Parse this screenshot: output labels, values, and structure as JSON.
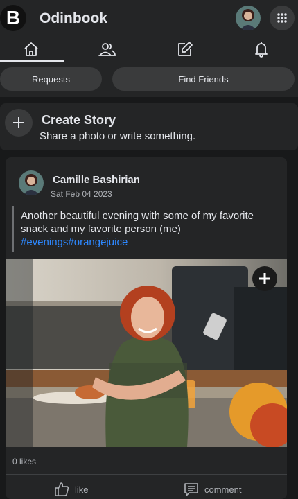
{
  "app": {
    "logo_letter": "B",
    "name": "Odinbook"
  },
  "nav": {
    "tabs": [
      {
        "name": "home",
        "active": true
      },
      {
        "name": "friends",
        "active": false
      },
      {
        "name": "create-post",
        "active": false
      },
      {
        "name": "notifications",
        "active": false
      }
    ],
    "buttons": {
      "requests": "Requests",
      "find_friends": "Find Friends"
    }
  },
  "story": {
    "title": "Create Story",
    "subtitle": "Share a photo or write something."
  },
  "post": {
    "author": "Camille Bashirian",
    "date": "Sat Feb 04 2023",
    "text": "Another beautiful evening with some of my favorite snack and my favorite person (me)",
    "tags": "#evenings#orangejuice",
    "likes": "0 likes",
    "like_label": "like",
    "comment_label": "comment"
  },
  "icons": {
    "home": "home-icon",
    "friends": "friends-icon",
    "edit": "edit-icon",
    "bell": "bell-icon",
    "grid": "grid-menu-icon",
    "plus": "plus-icon",
    "thumb": "thumbs-up-icon",
    "comment": "comment-icon"
  },
  "colors": {
    "background": "#18191a",
    "surface": "#242526",
    "pill": "#3a3b3c",
    "link": "#2d88ff"
  }
}
